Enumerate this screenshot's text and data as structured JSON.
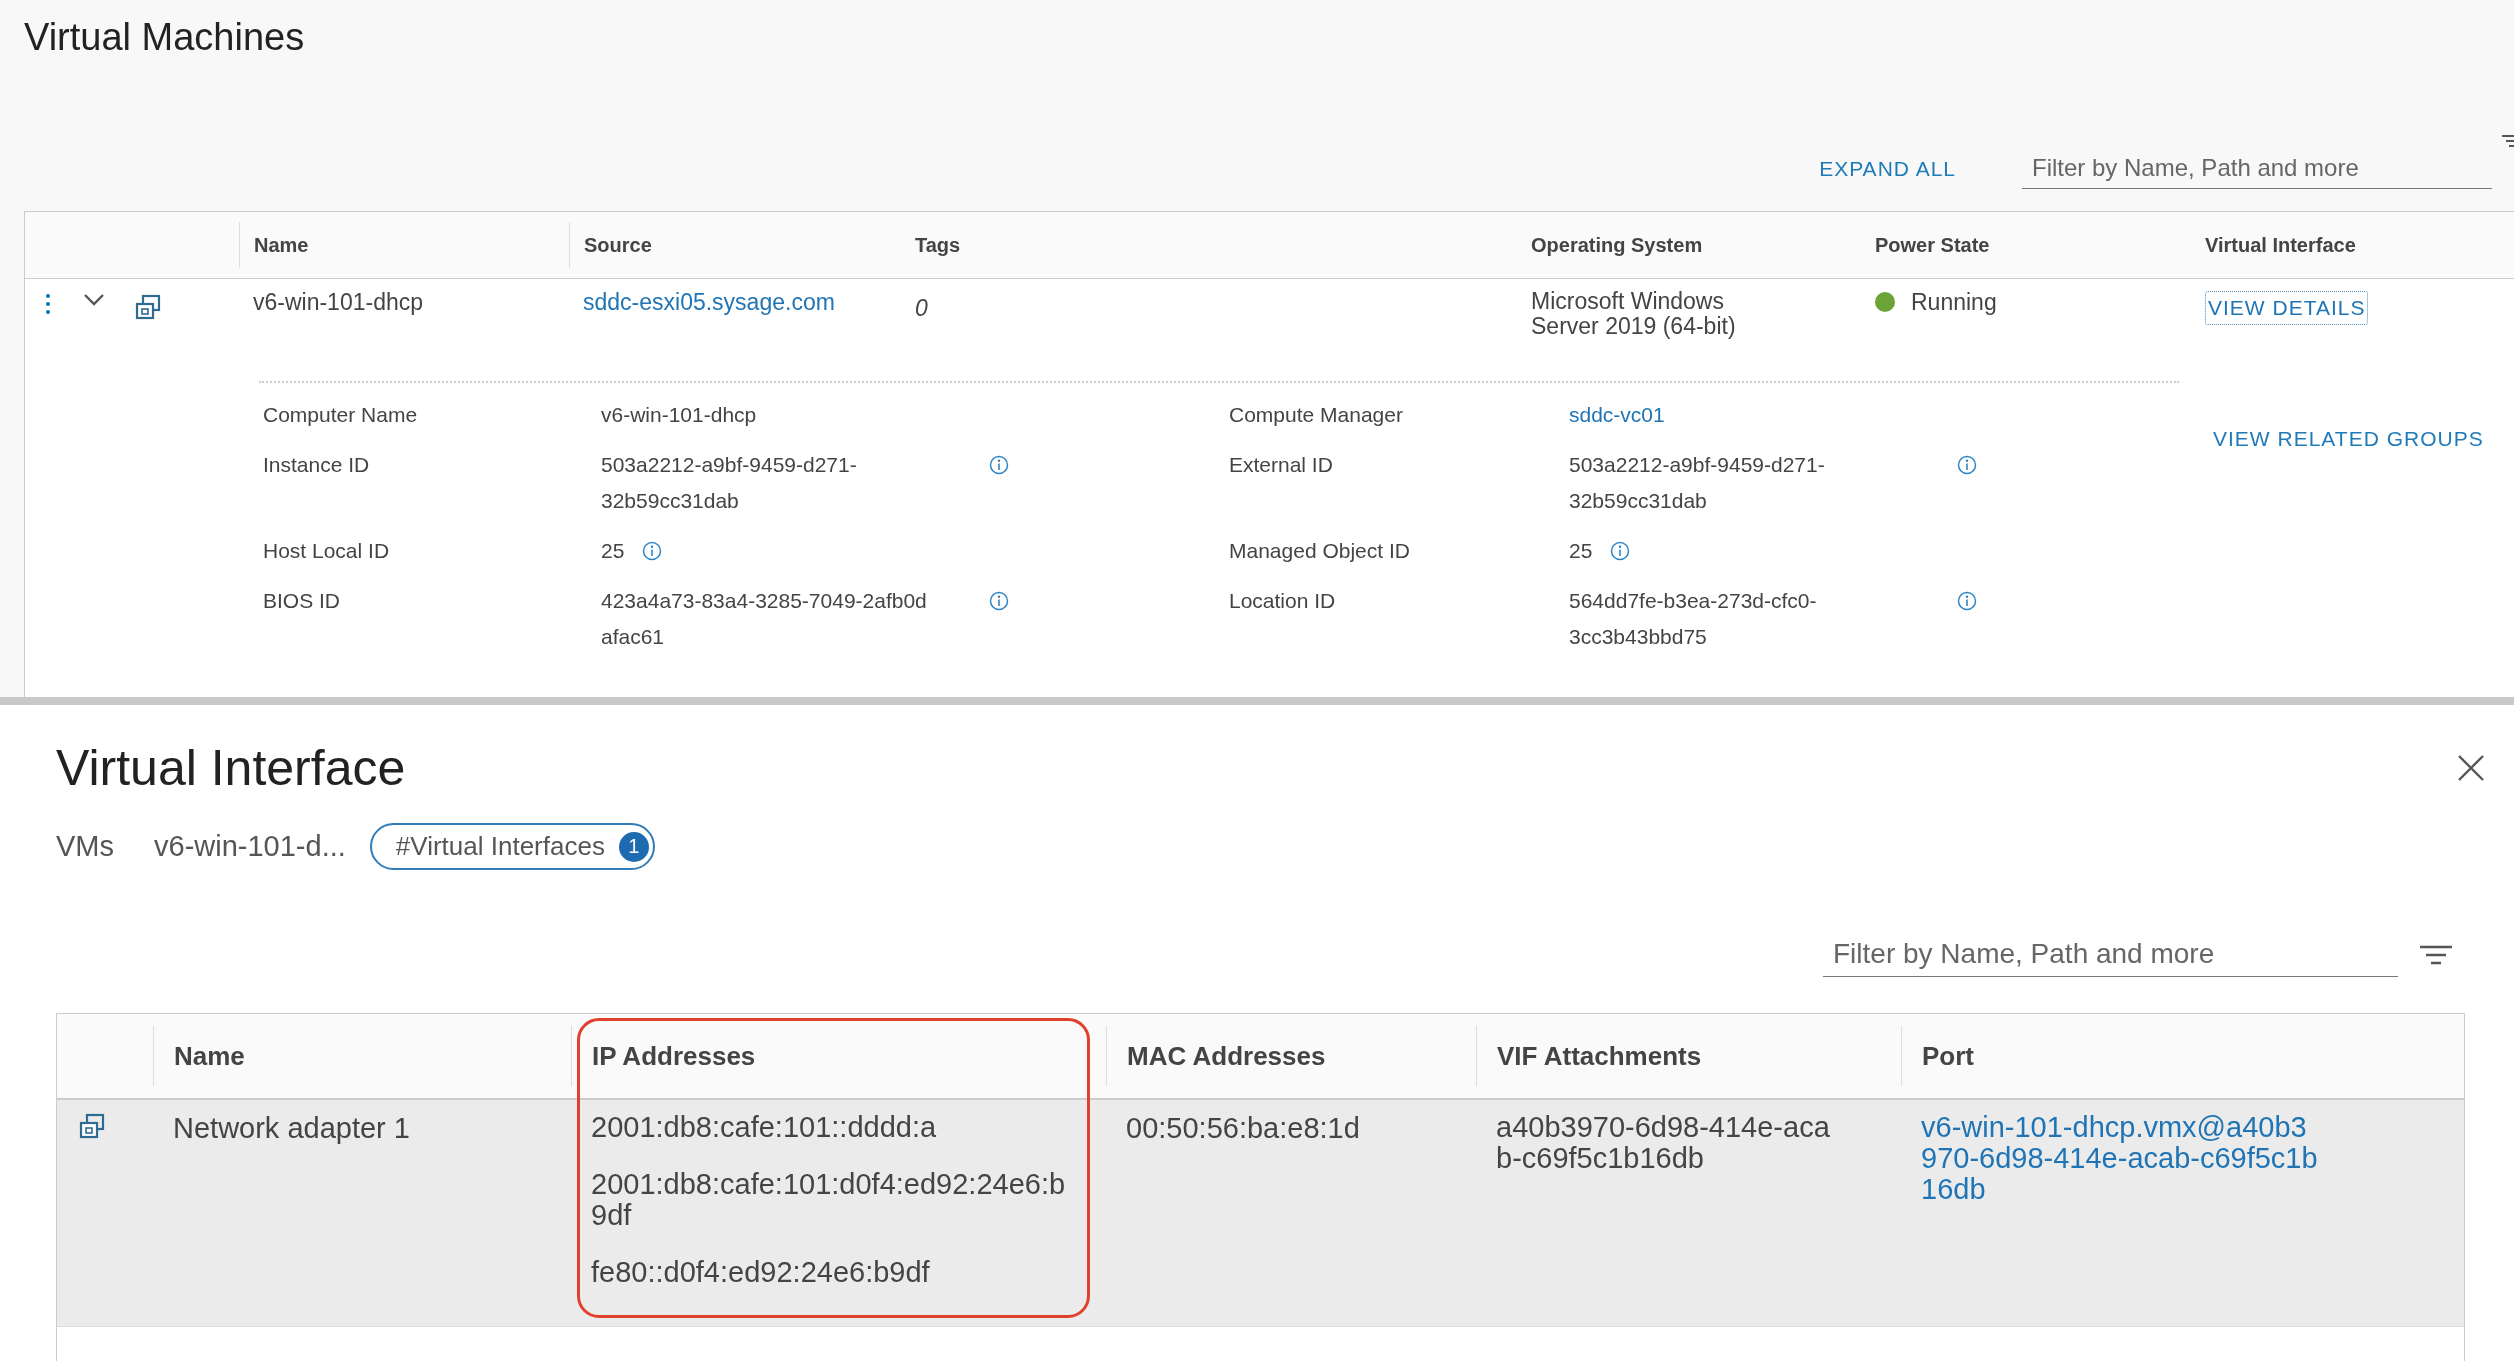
{
  "page_title": "Virtual Machines",
  "toolbar": {
    "expand_all": "EXPAND ALL",
    "filter": {
      "placeholder": "Filter by Name, Path and more"
    }
  },
  "vm_table": {
    "columns": [
      "Name",
      "Source",
      "Tags",
      "Operating System",
      "Power State",
      "Virtual Interface"
    ],
    "rows": [
      {
        "name": "v6-win-101-dhcp",
        "source": "sddc-esxi05.sysage.com",
        "tags": "0",
        "os": "Microsoft Windows Server 2019 (64-bit)",
        "power_state": {
          "label": "Running",
          "color": "#6ba337"
        },
        "virtual_interface": "VIEW DETAILS",
        "expanded": true,
        "related": "VIEW RELATED GROUPS",
        "details": [
          {
            "label": "Computer Name",
            "value": "v6-win-101-dhcp",
            "kind": "text",
            "info": false
          },
          {
            "label": "Compute Manager",
            "value": "sddc-vc01",
            "kind": "link",
            "info": false
          },
          {
            "label": "Instance ID",
            "value": "503a2212-a9bf-9459-d271-32b59cc31dab",
            "kind": "text",
            "info": true
          },
          {
            "label": "External ID",
            "value": "503a2212-a9bf-9459-d271-32b59cc31dab",
            "kind": "text",
            "info": true
          },
          {
            "label": "Host Local ID",
            "value": "25",
            "kind": "text",
            "info": true
          },
          {
            "label": "Managed Object ID",
            "value": "25",
            "kind": "text",
            "info": true
          },
          {
            "label": "BIOS ID",
            "value": "423a4a73-83a4-3285-7049-2afb0d afac61",
            "kind": "text",
            "info": true
          },
          {
            "label": "Location ID",
            "value": "564dd7fe-b3ea-273d-cfc0-3cc3b43bbd75",
            "kind": "text",
            "info": true
          }
        ]
      }
    ]
  },
  "panel": {
    "title": "Virtual Interface",
    "breadcrumbs": [
      {
        "label": "VMs",
        "selected": false
      },
      {
        "label": "v6-win-101-d...",
        "selected": false
      },
      {
        "label": "#Virtual Interfaces",
        "count": "1",
        "selected": true
      }
    ],
    "filter": {
      "placeholder": "Filter by Name, Path and more"
    },
    "table": {
      "columns": [
        {
          "label": "Name",
          "highlighted": false
        },
        {
          "label": "IP Addresses",
          "highlighted": true
        },
        {
          "label": "MAC Addresses",
          "highlighted": false
        },
        {
          "label": "VIF Attachments",
          "highlighted": false
        },
        {
          "label": "Port",
          "highlighted": false
        }
      ],
      "rows": [
        {
          "name": "Network adapter 1",
          "ip_addresses": [
            "2001:db8:cafe:101::dddd:a",
            "2001:db8:cafe:101:d0f4:ed92:24e6:b9df",
            "fe80::d0f4:ed92:24e6:b9df"
          ],
          "mac_addresses": "00:50:56:ba:e8:1d",
          "vif_attachments": "a40b3970-6d98-414e-acab-c69f5c1b16db",
          "port": "v6-win-101-dhcp.vmx@a40b3970-6d98-414e-acab-c69f5c1b16db",
          "selected": true
        }
      ]
    }
  }
}
